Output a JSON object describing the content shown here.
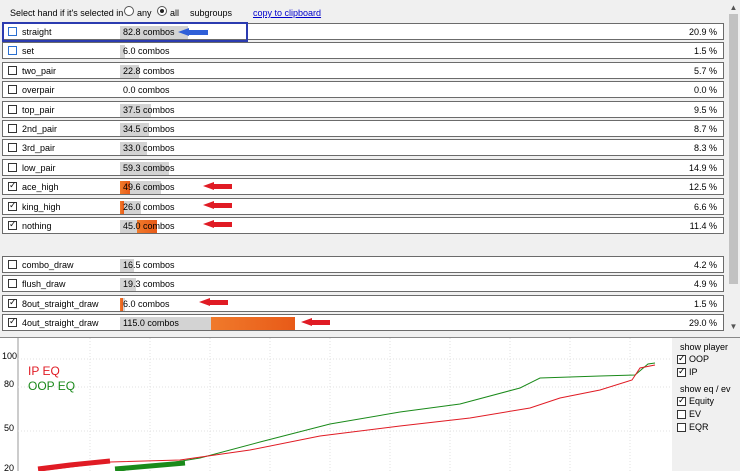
{
  "toolbar": {
    "select_label": "Select hand if it's selected in",
    "any_label": "any",
    "all_label": "all",
    "selected": "all",
    "subgroups_label": "subgroups",
    "copy_label": "copy to clipboard"
  },
  "made_hands": [
    {
      "name": "straight",
      "combos": "82.8 combos",
      "pct": "20.9 %",
      "checked": false,
      "selected_share": 0
    },
    {
      "name": "set",
      "combos": "6.0 combos",
      "pct": "1.5 %",
      "checked": false,
      "selected_share": 0
    },
    {
      "name": "two_pair",
      "combos": "22.8 combos",
      "pct": "5.7 %",
      "checked": false,
      "selected_share": 0
    },
    {
      "name": "overpair",
      "combos": "0.0 combos",
      "pct": "0.0 %",
      "checked": false,
      "selected_share": 0
    },
    {
      "name": "top_pair",
      "combos": "37.5 combos",
      "pct": "9.5 %",
      "checked": false,
      "selected_share": 0
    },
    {
      "name": "2nd_pair",
      "combos": "34.5 combos",
      "pct": "8.7 %",
      "checked": false,
      "selected_share": 0
    },
    {
      "name": "3rd_pair",
      "combos": "33.0 combos",
      "pct": "8.3 %",
      "checked": false,
      "selected_share": 0
    },
    {
      "name": "low_pair",
      "combos": "59.3 combos",
      "pct": "14.9 %",
      "checked": false,
      "selected_share": 0
    },
    {
      "name": "ace_high",
      "combos": "49.6 combos",
      "pct": "12.5 %",
      "checked": true,
      "selected_share": 0.25
    },
    {
      "name": "king_high",
      "combos": "26.0 combos",
      "pct": "6.6 %",
      "checked": true,
      "selected_share": 0.2
    },
    {
      "name": "nothing",
      "combos": "45.0 combos",
      "pct": "11.4 %",
      "checked": true,
      "selected_share": 0.55
    }
  ],
  "draws": [
    {
      "name": "combo_draw",
      "combos": "16.5 combos",
      "pct": "4.2 %",
      "checked": false,
      "selected_share": 0
    },
    {
      "name": "flush_draw",
      "combos": "19.3 combos",
      "pct": "4.9 %",
      "checked": false,
      "selected_share": 0
    },
    {
      "name": "8out_straight_draw",
      "combos": "6.0 combos",
      "pct": "1.5 %",
      "checked": true,
      "selected_share": 0.6
    },
    {
      "name": "4out_straight_draw",
      "combos": "115.0 combos",
      "pct": "29.0 %",
      "checked": true,
      "selected_share": 0.48
    }
  ],
  "chart": {
    "y_ticks": [
      "100",
      "80",
      "50",
      "20"
    ],
    "ip_label": "IP EQ",
    "oop_label": "OOP EQ",
    "ip_color": "#e01b24",
    "oop_color": "#1a8a1a"
  },
  "side_panel": {
    "show_player_label": "show player",
    "oop_label": "OOP",
    "ip_label": "IP",
    "show_eq_label": "show eq / ev",
    "equity_label": "Equity",
    "ev_label": "EV",
    "eqr_label": "EQR",
    "oop_checked": true,
    "ip_checked": true,
    "equity_checked": true,
    "ev_checked": false,
    "eqr_checked": false
  },
  "colors": {
    "bar_gray": "#d3d3d3",
    "fill_orange": "#ee6a22",
    "arrow_red": "#e01b24",
    "arrow_blue": "#3060d8",
    "highlight_blue": "#2b3bb0"
  }
}
